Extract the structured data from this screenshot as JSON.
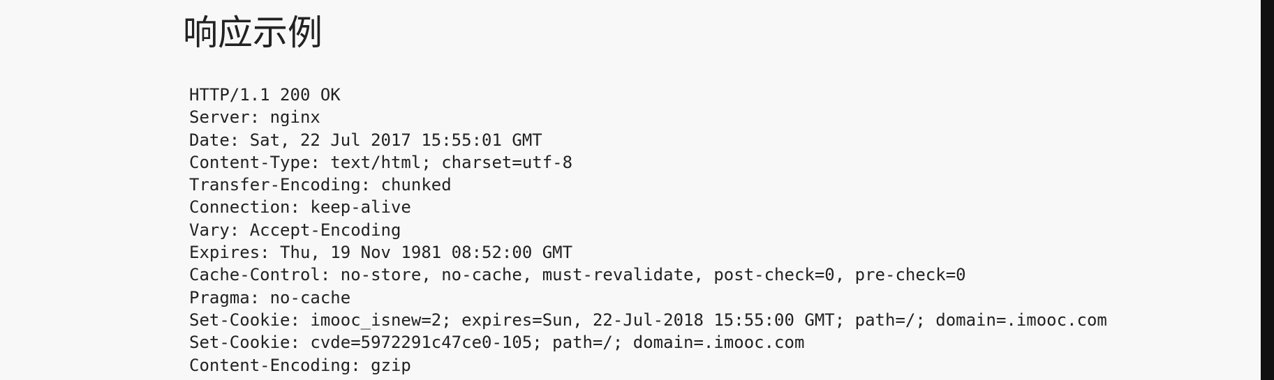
{
  "slide": {
    "title": "响应示例",
    "response_lines": [
      "HTTP/1.1 200 OK",
      "Server: nginx",
      "Date: Sat, 22 Jul 2017 15:55:01 GMT",
      "Content-Type: text/html; charset=utf-8",
      "Transfer-Encoding: chunked",
      "Connection: keep-alive",
      "Vary: Accept-Encoding",
      "Expires: Thu, 19 Nov 1981 08:52:00 GMT",
      "Cache-Control: no-store, no-cache, must-revalidate, post-check=0, pre-check=0",
      "Pragma: no-cache",
      "Set-Cookie: imooc_isnew=2; expires=Sun, 22-Jul-2018 15:55:00 GMT; path=/; domain=.imooc.com",
      "Set-Cookie: cvde=5972291c47ce0-105; path=/; domain=.imooc.com",
      "Content-Encoding: gzip"
    ]
  }
}
